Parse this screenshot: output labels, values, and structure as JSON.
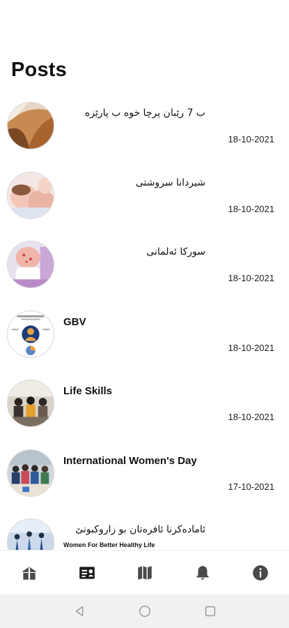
{
  "page": {
    "title": "Posts"
  },
  "posts": [
    {
      "title": "ب 7 رێبان پرچا خوه ب پارێزه",
      "subtitle": "",
      "date": "18-10-2021",
      "image": "hair-photo"
    },
    {
      "title": "شیردانا سروشتی",
      "subtitle": "",
      "date": "18-10-2021",
      "image": "breastfeeding-photo"
    },
    {
      "title": "سورکا ئەلمانی",
      "subtitle": "",
      "date": "18-10-2021",
      "image": "baby-measles-photo"
    },
    {
      "title": "GBV",
      "subtitle": "",
      "date": "18-10-2021",
      "image": "gbv-infographic"
    },
    {
      "title": "Life Skills",
      "subtitle": "",
      "date": "18-10-2021",
      "image": "life-skills-photo"
    },
    {
      "title": "International Women's Day",
      "subtitle": "",
      "date": "17-10-2021",
      "image": "womens-day-photo"
    },
    {
      "title": "ئامادەکرنا ئافرەتان بو زاروکبونێ",
      "subtitle": "Women For Better Healthy Life",
      "date": "",
      "image": "yoga-class-photo"
    }
  ],
  "bottom_nav": [
    {
      "icon": "home-gift-icon",
      "active": false
    },
    {
      "icon": "news-card-icon",
      "active": true
    },
    {
      "icon": "map-icon",
      "active": false
    },
    {
      "icon": "bell-icon",
      "active": false
    },
    {
      "icon": "info-icon",
      "active": false
    }
  ],
  "system_nav": [
    {
      "icon": "back-triangle-icon"
    },
    {
      "icon": "home-circle-icon"
    },
    {
      "icon": "recents-square-icon"
    }
  ],
  "colors": {
    "nav_icon": "#4a4a4a",
    "nav_icon_active": "#1a1a1a",
    "date_text": "#222222",
    "system_bar": "#f1f1f1"
  }
}
